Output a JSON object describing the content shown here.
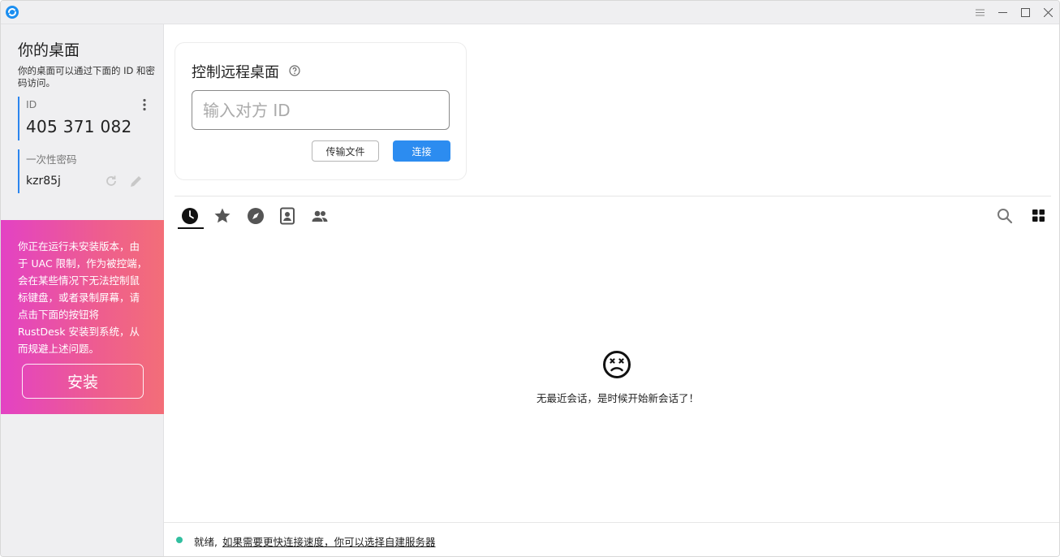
{
  "sidebar": {
    "title": "你的桌面",
    "description": "你的桌面可以通过下面的 ID 和密码访问。",
    "id_label": "ID",
    "id_value": "405 371 082",
    "password_label": "一次性密码",
    "password_value": "kzr85j",
    "install_notice": "你正在运行未安装版本，由于 UAC 限制，作为被控端，会在某些情况下无法控制鼠标键盘，或者录制屏幕，请点击下面的按钮将 RustDesk 安装到系统，从而规避上述问题。",
    "install_button": "安装"
  },
  "connect": {
    "title": "控制远程桌面",
    "input_placeholder": "输入对方 ID",
    "input_value": "",
    "transfer_button": "传输文件",
    "connect_button": "连接"
  },
  "tabs": [
    {
      "icon": "recent-icon",
      "active": true
    },
    {
      "icon": "star-icon",
      "active": false
    },
    {
      "icon": "compass-icon",
      "active": false
    },
    {
      "icon": "address-book-icon",
      "active": false
    },
    {
      "icon": "group-icon",
      "active": false
    }
  ],
  "empty_state": {
    "message": "无最近会话，是时候开始新会话了！"
  },
  "status": {
    "state": "就绪,",
    "link": "如果需要更快连接速度，你可以选择自建服务器",
    "dot_color": "#32bfa0"
  },
  "colors": {
    "accent": "#2c8cf0",
    "install_gradient_start": "#e342c4",
    "install_gradient_end": "#f36e78"
  }
}
